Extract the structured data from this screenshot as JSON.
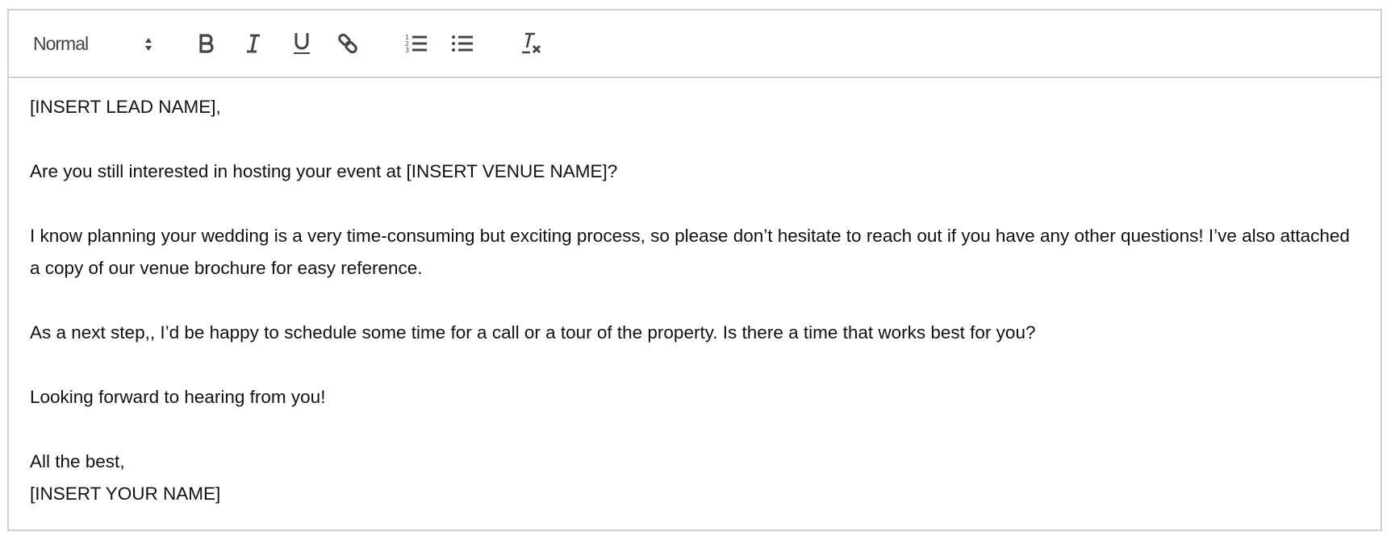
{
  "toolbar": {
    "format_select": {
      "value": "Normal"
    },
    "buttons": [
      {
        "name": "bold",
        "icon": "bold-icon"
      },
      {
        "name": "italic",
        "icon": "italic-icon"
      },
      {
        "name": "underline",
        "icon": "underline-icon"
      },
      {
        "name": "link",
        "icon": "link-icon"
      },
      {
        "name": "ordered-list",
        "icon": "ordered-list-icon"
      },
      {
        "name": "bullet-list",
        "icon": "bullet-list-icon"
      },
      {
        "name": "clear-formatting",
        "icon": "clear-formatting-icon"
      }
    ]
  },
  "body": {
    "lines": [
      "[INSERT LEAD NAME],",
      "",
      "Are you still interested in hosting your event at [INSERT VENUE NAME]?",
      "",
      "I know planning your wedding is a very time-consuming but exciting process, so please don’t hesitate to reach out if you have any other questions! I’ve also attached a copy of our venue brochure for easy reference.",
      "",
      "As a next step,, I’d be happy to schedule some time for a call or a tour of the property. Is there a time that works best for you?",
      "",
      "Looking forward to hearing from you!",
      "",
      "All the best,",
      "[INSERT YOUR NAME]"
    ]
  }
}
